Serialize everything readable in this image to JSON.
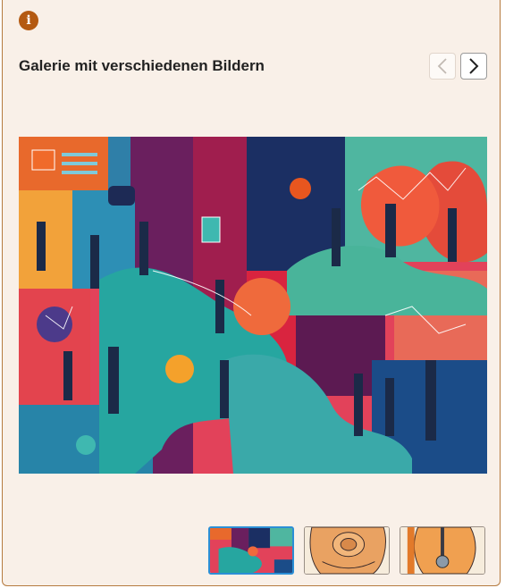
{
  "gallery": {
    "title": "Galerie mit verschiedenen Bildern",
    "info_icon_glyph": "i",
    "icons": {
      "info": "info-icon",
      "prev": "chevron-left-icon",
      "next": "chevron-right-icon"
    },
    "accent_color": "#b45a12",
    "background_color": "#f9f0e8",
    "active_thumbnail_index": 0,
    "thumbnails": [
      {
        "depicts": "colorful-illustration"
      },
      {
        "depicts": "orange-instrument-closeup"
      },
      {
        "depicts": "orange-lamp-closeup"
      }
    ]
  }
}
